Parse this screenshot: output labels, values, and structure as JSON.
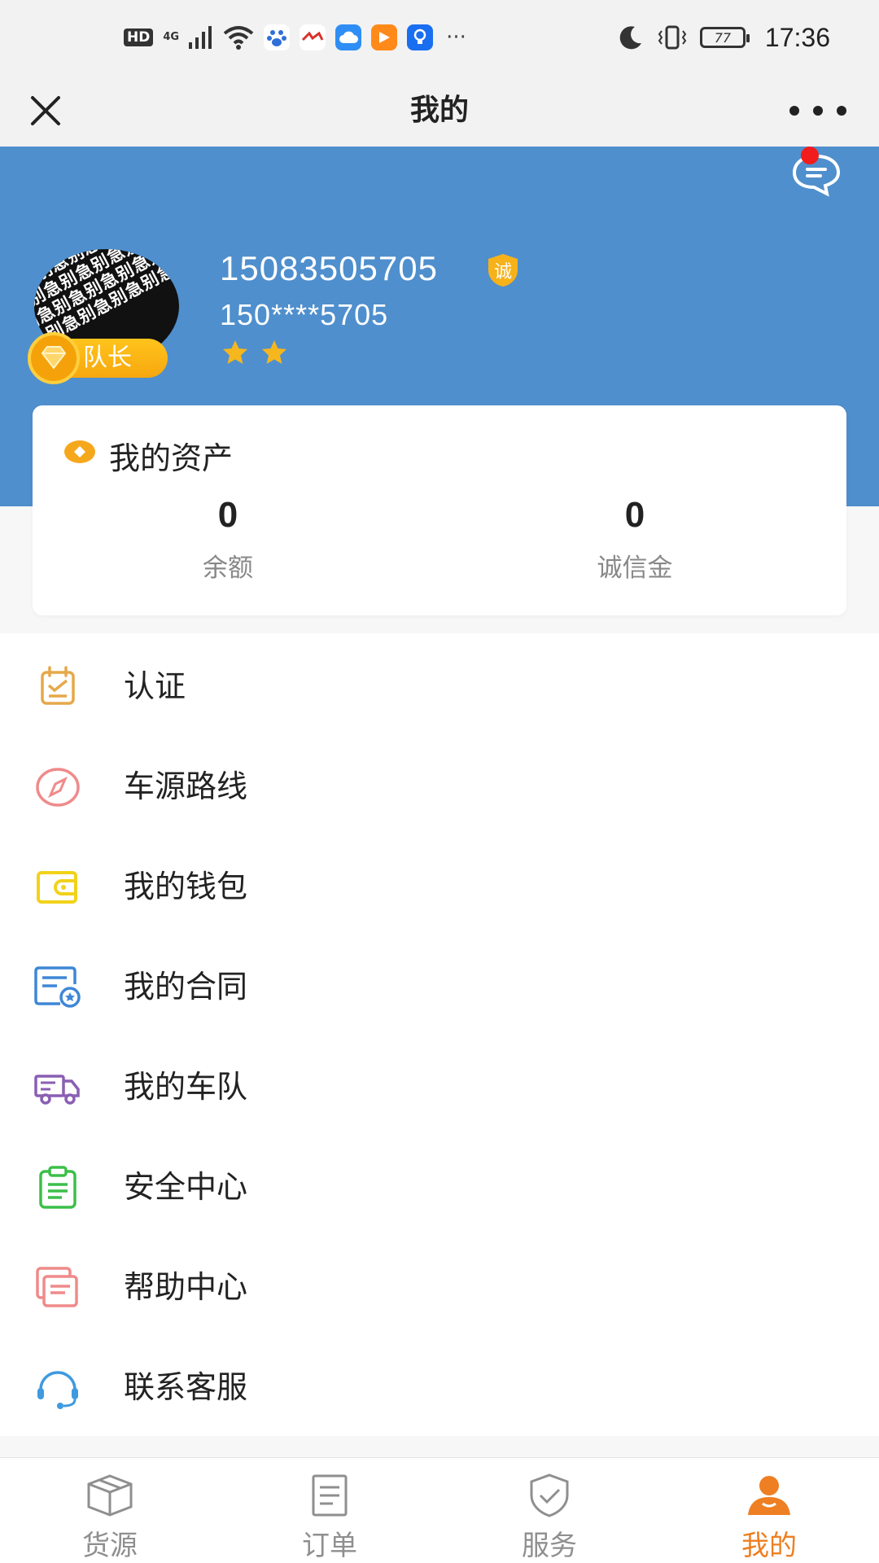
{
  "status_bar": {
    "hd": "HD",
    "network": "4G",
    "battery": "77",
    "time": "17:36"
  },
  "header": {
    "title": "我的"
  },
  "profile": {
    "avatar_watermark": "急别急别急别急别急别急别急别急别急别急别急别急别急别急别急别急别急别急别急别急别急别急别",
    "badge_label": "队长",
    "phone": "15083505705",
    "verified_badge": "诚",
    "masked_phone": "150****5705",
    "stars": 2
  },
  "assets": {
    "title": "我的资产",
    "items": [
      {
        "value": "0",
        "label": "余额"
      },
      {
        "value": "0",
        "label": "诚信金"
      }
    ]
  },
  "menu": {
    "items": [
      {
        "label": "认证",
        "icon": "certification-icon",
        "color": "#e6a84a"
      },
      {
        "label": "车源路线",
        "icon": "compass-icon",
        "color": "#f08a8a"
      },
      {
        "label": "我的钱包",
        "icon": "wallet-icon",
        "color": "#f2d21a"
      },
      {
        "label": "我的合同",
        "icon": "contract-icon",
        "color": "#3f87d6"
      },
      {
        "label": "我的车队",
        "icon": "truck-icon",
        "color": "#8a5fb3"
      },
      {
        "label": "安全中心",
        "icon": "clipboard-icon",
        "color": "#3cbf4a"
      },
      {
        "label": "帮助中心",
        "icon": "help-docs-icon",
        "color": "#f08a8a"
      },
      {
        "label": "联系客服",
        "icon": "headset-icon",
        "color": "#3f9ae0"
      }
    ]
  },
  "tabbar": {
    "tabs": [
      {
        "label": "货源",
        "icon": "box-icon"
      },
      {
        "label": "订单",
        "icon": "document-icon"
      },
      {
        "label": "服务",
        "icon": "shield-check-icon"
      },
      {
        "label": "我的",
        "icon": "user-icon",
        "active": true
      }
    ]
  },
  "colors": {
    "profile_bg": "#4f8fcd",
    "accent": "#ee7f22",
    "badge_gold": "#f7a70e"
  }
}
